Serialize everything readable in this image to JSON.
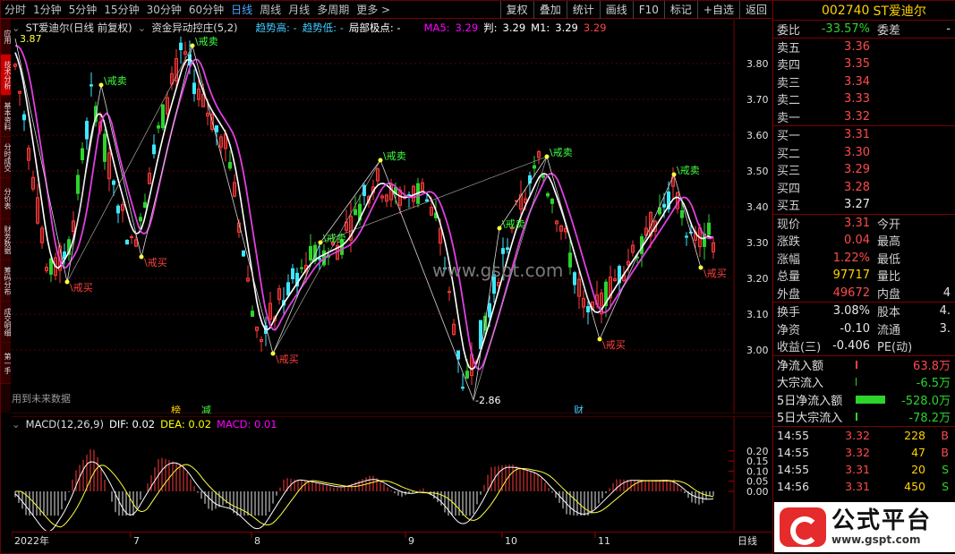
{
  "topbar": {
    "periods": [
      "分时",
      "1分钟",
      "5分钟",
      "15分钟",
      "30分钟",
      "60分钟",
      "日线",
      "周线",
      "月线",
      "多周期",
      "更多 >"
    ],
    "active_period": "日线",
    "tools": [
      "复权",
      "叠加",
      "统计",
      "画线",
      "F10",
      "标记",
      "+自选",
      "返回"
    ]
  },
  "left_tabs": [
    "应用",
    "技术分析",
    "基本资料",
    "分时成交",
    "分价表",
    "财务数据",
    "筹码分布",
    "成交明细",
    "第一手"
  ],
  "info": {
    "stock": "ST爱迪尔(日线 前复权)",
    "indicator": "资金异动控庄(5,2)",
    "trend_high": "趋势高: -",
    "trend_low": "趋势低: -",
    "local_extreme": "局部极点: -",
    "ma5_label": "MA5:",
    "ma5_value": "3.29",
    "pan_label": "判:",
    "pan_value": "3.29",
    "m1_label": "M1:",
    "m1_value": "3.29",
    "last_value": "3.29",
    "future_data": "用到未来数据"
  },
  "price_axis": [
    "3.80",
    "3.70",
    "3.60",
    "3.50",
    "3.40",
    "3.30",
    "3.20",
    "3.10",
    "3.00"
  ],
  "annotations": {
    "sell": "\\戒卖",
    "buy": "\\戒买",
    "high_price": "3.87",
    "low_price": "2.86",
    "bang": "榜",
    "jian": "减",
    "cai": "财",
    "watermark": "www.gspt.com"
  },
  "macd": {
    "label": "MACD(12,26,9)",
    "dif": "DIF: 0.02",
    "dea": "DEA: 0.02",
    "macd": "MACD: 0.01",
    "axis": [
      "0.20",
      "0.15",
      "0.10",
      "0.05",
      "0.00"
    ]
  },
  "xaxis": {
    "labels": [
      "2022年",
      "7",
      "8",
      "9",
      "10",
      "11"
    ],
    "period_label": "日线"
  },
  "quote": {
    "code": "002740",
    "name": "ST爱迪尔",
    "weibi_label": "委比",
    "weibi": "-33.57%",
    "weicha_label": "委差",
    "weicha": "-",
    "sells": [
      {
        "label": "卖五",
        "price": "3.36",
        "vol": ""
      },
      {
        "label": "卖四",
        "price": "3.35",
        "vol": ""
      },
      {
        "label": "卖三",
        "price": "3.34",
        "vol": ""
      },
      {
        "label": "卖二",
        "price": "3.33",
        "vol": ""
      },
      {
        "label": "卖一",
        "price": "3.32",
        "vol": ""
      }
    ],
    "buys": [
      {
        "label": "买一",
        "price": "3.31",
        "vol": ""
      },
      {
        "label": "买二",
        "price": "3.30",
        "vol": ""
      },
      {
        "label": "买三",
        "price": "3.29",
        "vol": ""
      },
      {
        "label": "买四",
        "price": "3.28",
        "vol": ""
      },
      {
        "label": "买五",
        "price": "3.27",
        "vol": ""
      }
    ],
    "stats": [
      {
        "l1": "现价",
        "v1": "3.31",
        "c1": "red",
        "l2": "今开",
        "v2": ""
      },
      {
        "l1": "涨跌",
        "v1": "0.04",
        "c1": "red",
        "l2": "最高",
        "v2": ""
      },
      {
        "l1": "涨幅",
        "v1": "1.22%",
        "c1": "red",
        "l2": "最低",
        "v2": ""
      },
      {
        "l1": "总量",
        "v1": "97717",
        "c1": "yellow",
        "l2": "量比",
        "v2": ""
      },
      {
        "l1": "外盘",
        "v1": "49672",
        "c1": "red",
        "l2": "内盘",
        "v2": "4"
      }
    ],
    "stats2": [
      {
        "l1": "换手",
        "v1": "3.08%",
        "c1": "white",
        "l2": "股本",
        "v2": "4."
      },
      {
        "l1": "净资",
        "v1": "-0.10",
        "c1": "white",
        "l2": "流通",
        "v2": "3."
      },
      {
        "l1": "收益(三)",
        "v1": "-0.406",
        "c1": "white",
        "l2": "PE(动)",
        "v2": ""
      }
    ],
    "flows": [
      {
        "label": "净流入额",
        "value": "63.8万",
        "color": "red",
        "bar": 4
      },
      {
        "label": "大宗流入",
        "value": "-6.5万",
        "color": "green",
        "bar": 2
      },
      {
        "label": "5日净流入额",
        "value": "-528.0万",
        "color": "green",
        "bar": 60
      },
      {
        "label": "5日大宗流入",
        "value": "-78.2万",
        "color": "green",
        "bar": 3
      }
    ],
    "trades": [
      {
        "time": "14:55",
        "price": "3.32",
        "vol": "228",
        "side": "B"
      },
      {
        "time": "14:55",
        "price": "3.32",
        "vol": "47",
        "side": "B"
      },
      {
        "time": "14:55",
        "price": "3.31",
        "vol": "20",
        "side": "S"
      },
      {
        "time": "14:56",
        "price": "3.31",
        "vol": "450",
        "side": "S"
      }
    ]
  },
  "logo": {
    "cn": "公式平台",
    "url": "www.gspt.com"
  }
}
